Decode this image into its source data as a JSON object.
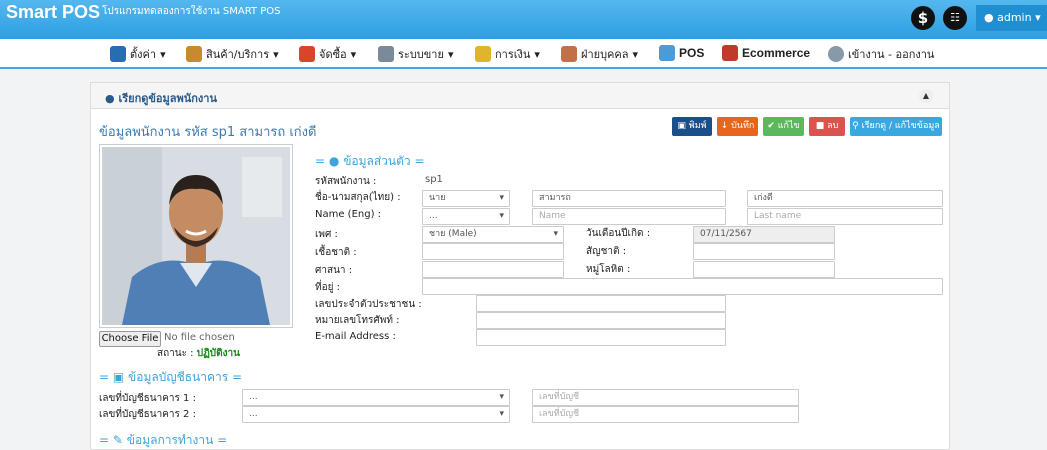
{
  "topbar": {
    "brand": "Smart POS",
    "subtitle": "โปรแกรมทดลองการใช้งาน SMART POS",
    "user": "admin"
  },
  "nav": [
    {
      "label": "ตั้งค่า",
      "icon": "settings-icon"
    },
    {
      "label": "สินค้า/บริการ",
      "icon": "products-icon"
    },
    {
      "label": "จัดซื้อ",
      "icon": "purchase-cart-icon"
    },
    {
      "label": "ระบบขาย",
      "icon": "sales-register-icon"
    },
    {
      "label": "การเงิน",
      "icon": "finance-icon"
    },
    {
      "label": "ฝ่ายบุคคล",
      "icon": "hr-people-icon"
    },
    {
      "label": "POS",
      "icon": "pos-basket-icon"
    },
    {
      "label": "Ecommerce",
      "icon": "ecommerce-icon"
    },
    {
      "label": "เข้างาน - ออกงาน",
      "icon": "attendance-icon"
    }
  ],
  "panel": {
    "title": "เรียกดูข้อมูลพนักงาน",
    "employee_heading": "ข้อมูลพนักงาน รหัส sp1 สามารถ เก่งดี",
    "buttons": {
      "print": "พิมพ์",
      "save": "บันทึก",
      "edit": "แก้ไข",
      "delete": "ลบ",
      "search": "เรียกดู / แก้ไขข้อมูล"
    },
    "choose_file": "Choose File",
    "no_file": "No file chosen",
    "status_label": "สถานะ :",
    "status_value": "ปฏิบัติงาน"
  },
  "personal": {
    "section_title": "ข้อมูลส่วนตัว",
    "code_label": "รหัสพนักงาน :",
    "code_value": "sp1",
    "name_th_label": "ชื่อ-นามสกุล(ไทย) :",
    "prefix_th": "นาย",
    "first_th": "สามารถ",
    "last_th": "เก่งดี",
    "name_en_label": "Name (Eng) :",
    "prefix_en": "...",
    "first_en_ph": "Name",
    "last_en_ph": "Last name",
    "gender_label": "เพศ :",
    "gender_value": "ชาย (Male)",
    "birth_label": "วันเดือนปีเกิด :",
    "birth_value": "07/11/2567",
    "race_label": "เชื้อชาติ :",
    "nationality_label": "สัญชาติ :",
    "religion_label": "ศาสนา :",
    "blood_label": "หมู่โลหิต :",
    "address_label": "ที่อยู่ :",
    "id_card_label": "เลขประจำตัวประชาชน :",
    "phone_label": "หมายเลขโทรศัพท์ :",
    "email_label": "E-mail Address :"
  },
  "bank": {
    "section_title": "ข้อมูลบัญชีธนาคาร",
    "acc1_label": "เลขที่บัญชีธนาคาร 1 :",
    "acc2_label": "เลขที่บัญชีธนาคาร 2 :",
    "bank_select": "...",
    "acc_ph": "เลขที่บัญชี"
  },
  "work": {
    "section_title": "ข้อมูลการทำงาน"
  },
  "colors": {
    "topbar": "#2c9fe2",
    "print": "#1b4f8a",
    "save": "#e8661c",
    "edit": "#5cb85c",
    "delete": "#d9534f",
    "search": "#3aa8e0"
  }
}
